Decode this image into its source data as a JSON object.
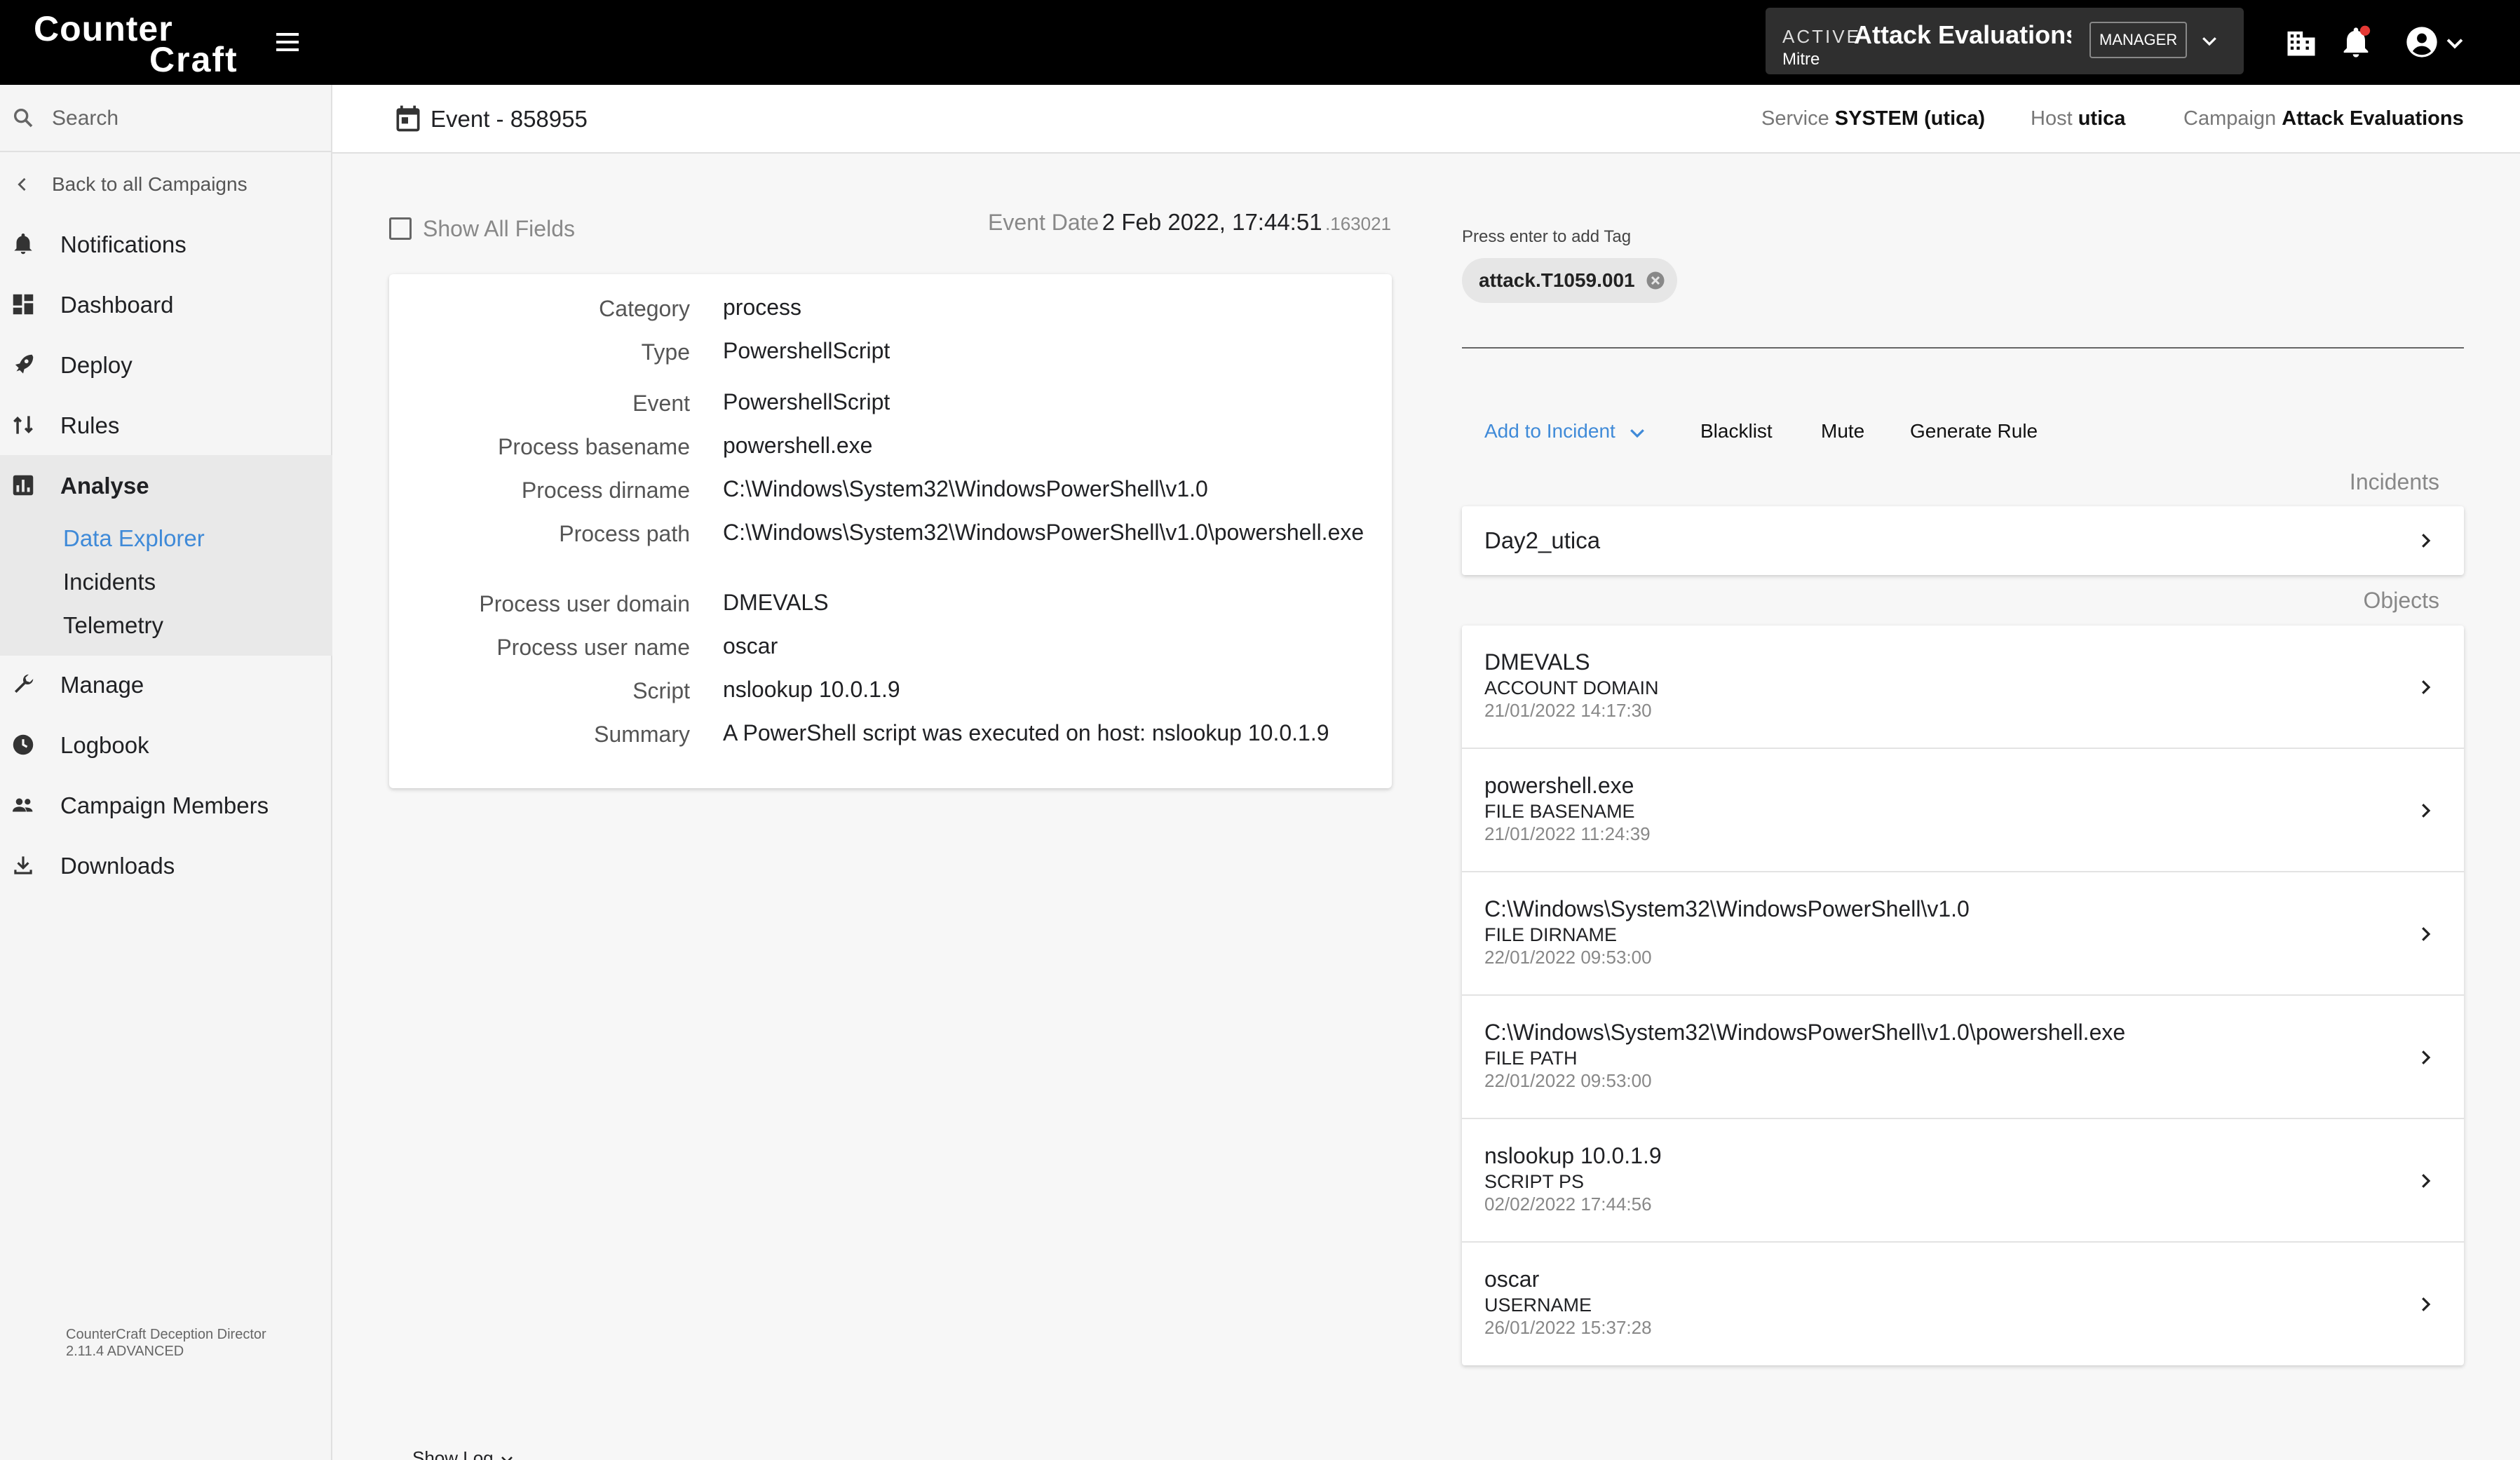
{
  "brand": {
    "line1": "Counter",
    "line2": "Craft"
  },
  "campaign_selector": {
    "status": "ACTIVE",
    "name": "Attack Evaluations",
    "org": "Mitre",
    "role": "MANAGER"
  },
  "sidebar": {
    "search_placeholder": "Search",
    "back_label": "Back to all Campaigns",
    "items": [
      {
        "label": "Notifications",
        "icon": "bell-icon"
      },
      {
        "label": "Dashboard",
        "icon": "dashboard-icon"
      },
      {
        "label": "Deploy",
        "icon": "rocket-icon"
      },
      {
        "label": "Rules",
        "icon": "rules-icon"
      },
      {
        "label": "Analyse",
        "icon": "chart-icon"
      },
      {
        "label": "Manage",
        "icon": "wrench-icon"
      },
      {
        "label": "Logbook",
        "icon": "clock-icon"
      },
      {
        "label": "Campaign Members",
        "icon": "people-icon"
      },
      {
        "label": "Downloads",
        "icon": "download-icon"
      }
    ],
    "analyse_sub": [
      {
        "label": "Data Explorer",
        "active": true
      },
      {
        "label": "Incidents"
      },
      {
        "label": "Telemetry"
      }
    ],
    "version_line1": "CounterCraft Deception Director",
    "version_line2": "2.11.4 ADVANCED"
  },
  "header": {
    "title": "Event - 858955",
    "service_label": "Service",
    "service_value": "SYSTEM (utica)",
    "host_label": "Host",
    "host_value": "utica",
    "campaign_label": "Campaign",
    "campaign_value": "Attack Evaluations"
  },
  "event": {
    "show_all_label": "Show All Fields",
    "date_label": "Event Date",
    "date_value": "2 Feb 2022, 17:44:51",
    "date_ms": ".163021",
    "fields": [
      {
        "label": "Category",
        "value": "process"
      },
      {
        "label": "Type",
        "value": "PowershellScript"
      },
      {
        "label": "Event",
        "value": "PowershellScript"
      },
      {
        "label": "Process basename",
        "value": "powershell.exe"
      },
      {
        "label": "Process dirname",
        "value": "C:\\Windows\\System32\\WindowsPowerShell\\v1.0"
      },
      {
        "label": "Process path",
        "value": "C:\\Windows\\System32\\WindowsPowerShell\\v1.0\\powershell.exe"
      },
      {
        "label": "Process user domain",
        "value": "DMEVALS"
      },
      {
        "label": "Process user name",
        "value": "oscar"
      },
      {
        "label": "Script",
        "value": "nslookup 10.0.1.9"
      },
      {
        "label": "Summary",
        "value": "A PowerShell script was executed on host: nslookup 10.0.1.9"
      }
    ]
  },
  "tags": {
    "hint": "Press enter to add Tag",
    "items": [
      "attack.T1059.001"
    ]
  },
  "actions": {
    "add_to_incident": "Add to Incident",
    "blacklist": "Blacklist",
    "mute": "Mute",
    "generate_rule": "Generate Rule"
  },
  "incidents": {
    "title": "Incidents",
    "items": [
      "Day2_utica"
    ]
  },
  "objects": {
    "title": "Objects",
    "items": [
      {
        "value": "DMEVALS",
        "type": "ACCOUNT DOMAIN",
        "date": "21/01/2022 14:17:30"
      },
      {
        "value": "powershell.exe",
        "type": "FILE BASENAME",
        "date": "21/01/2022 11:24:39"
      },
      {
        "value": "C:\\Windows\\System32\\WindowsPowerShell\\v1.0",
        "type": "FILE DIRNAME",
        "date": "22/01/2022 09:53:00"
      },
      {
        "value": "C:\\Windows\\System32\\WindowsPowerShell\\v1.0\\powershell.exe",
        "type": "FILE PATH",
        "date": "22/01/2022 09:53:00"
      },
      {
        "value": "nslookup 10.0.1.9",
        "type": "SCRIPT PS",
        "date": "02/02/2022 17:44:56"
      },
      {
        "value": "oscar",
        "type": "USERNAME",
        "date": "26/01/2022 15:37:28"
      }
    ]
  },
  "show_log_label": "Show Log",
  "colors": {
    "accent": "#3f8ad8",
    "topbar": "#000000",
    "notification_dot": "#e53935"
  }
}
